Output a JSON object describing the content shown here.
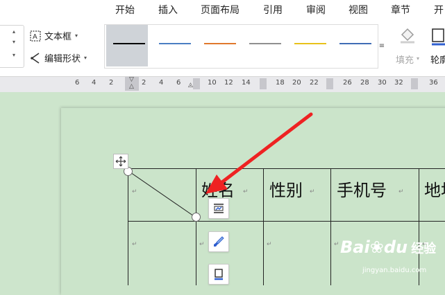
{
  "menu": {
    "tabs": [
      {
        "label": "开始"
      },
      {
        "label": "插入"
      },
      {
        "label": "页面布局"
      },
      {
        "label": "引用"
      },
      {
        "label": "审阅"
      },
      {
        "label": "视图"
      },
      {
        "label": "章节"
      },
      {
        "label": "开"
      }
    ]
  },
  "ribbon": {
    "textbox_label": "文本框",
    "edit_shape_label": "编辑形状",
    "line_styles": [
      {
        "color": "#000000",
        "selected": true
      },
      {
        "color": "#4a7ec2",
        "selected": false
      },
      {
        "color": "#e0782c",
        "selected": false
      },
      {
        "color": "#8f8f8f",
        "selected": false
      },
      {
        "color": "#e8c11a",
        "selected": false
      },
      {
        "color": "#3f6db5",
        "selected": false
      }
    ],
    "fill_label": "填充",
    "outline_label": "轮廓"
  },
  "ruler": {
    "left_numbers": [
      "6",
      "4",
      "2"
    ],
    "right_numbers": [
      "2",
      "4",
      "6",
      "8",
      "10",
      "12",
      "14",
      "18",
      "20",
      "22",
      "26",
      "28",
      "30",
      "32",
      "36"
    ]
  },
  "table": {
    "headers": [
      "姓名",
      "性别",
      "手机号",
      "地址"
    ],
    "paragraph_mark": "↵"
  },
  "watermark": {
    "logo": "Bai",
    "logo_suffix": "du",
    "text": "经验",
    "url": "jingyan.baidu.com"
  },
  "colors": {
    "doc_background": "#cde5cc",
    "arrow": "#ee2222",
    "accent": "#2f5fd0"
  }
}
